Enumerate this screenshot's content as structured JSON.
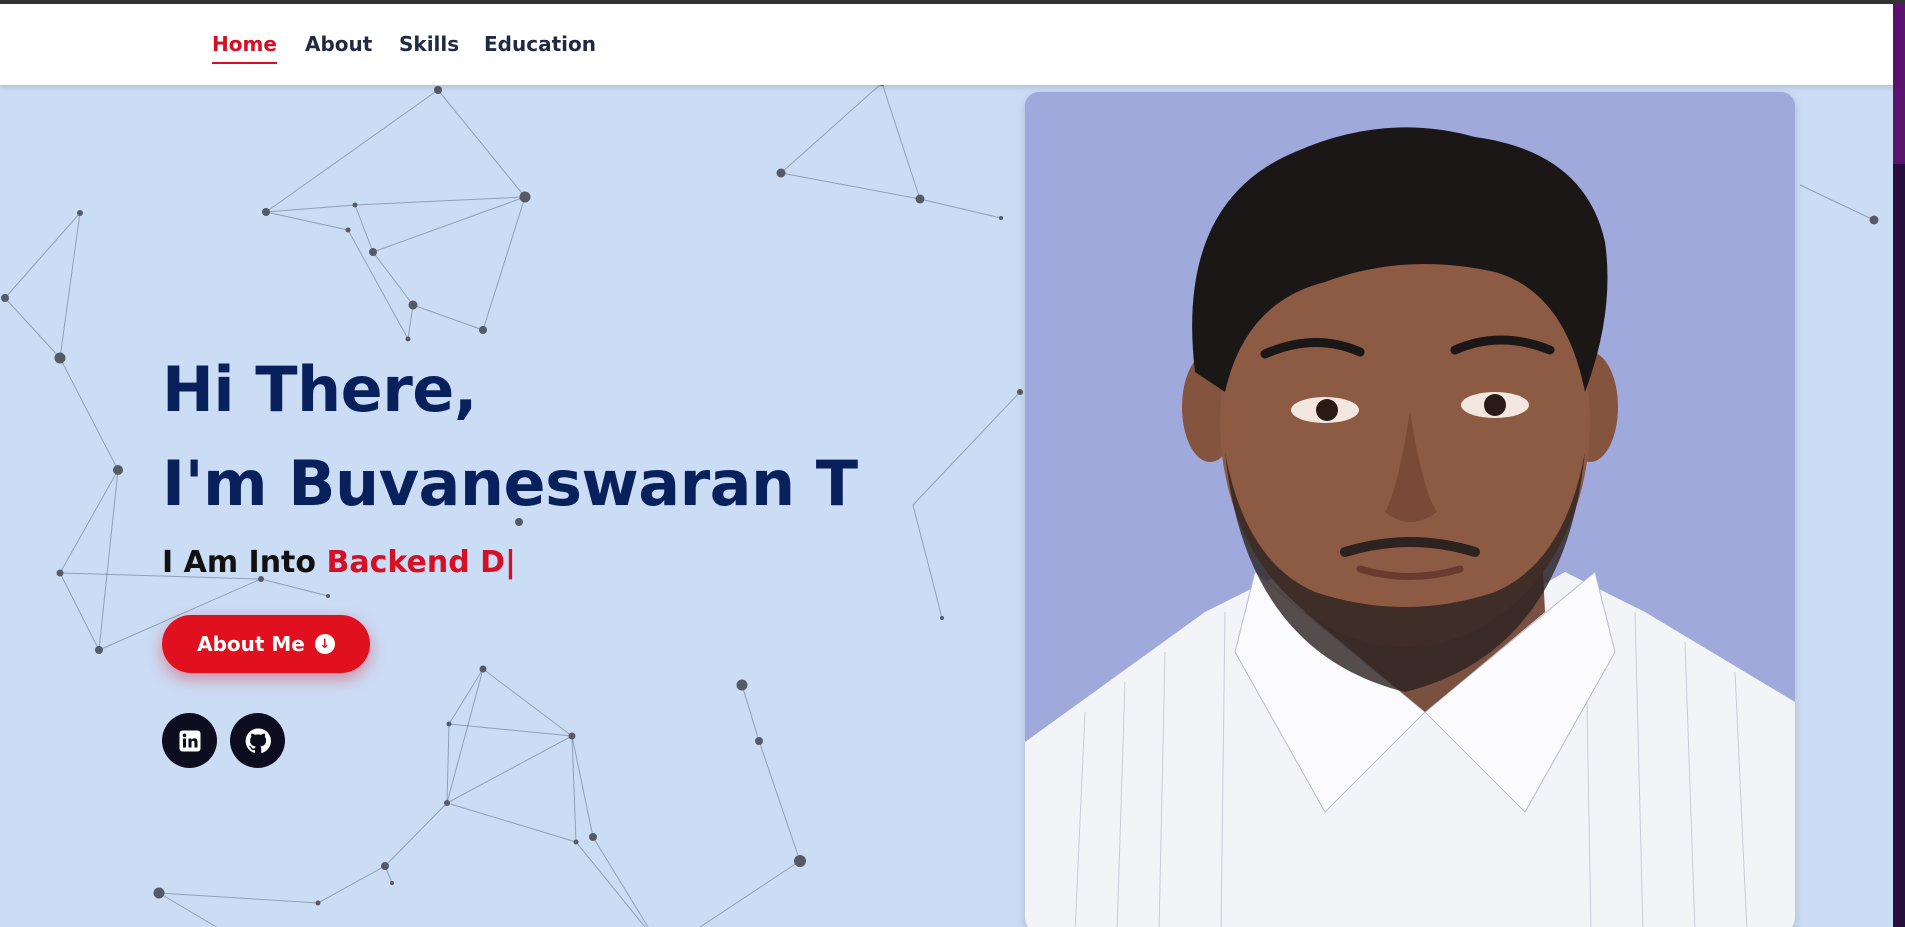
{
  "nav": {
    "items": [
      {
        "label": "Home",
        "active": true
      },
      {
        "label": "About",
        "active": false
      },
      {
        "label": "Skills",
        "active": false
      },
      {
        "label": "Education",
        "active": false
      }
    ]
  },
  "hero": {
    "greeting": "Hi There,",
    "name_line": "I'm Buvaneswaran T",
    "typing_prefix": "I Am Into",
    "typing_text": "Backend D|",
    "button_label": "About Me",
    "button_icon": "arrow-down-circle-icon",
    "socials": [
      {
        "icon": "linkedin-icon"
      },
      {
        "icon": "github-icon"
      }
    ]
  },
  "colors": {
    "accent": "#d50f24",
    "hero_background": "#cbdcf5",
    "heading": "#08205c",
    "photo_background": "#9fa9dc"
  },
  "photo": {
    "subject": "profile-photo"
  }
}
